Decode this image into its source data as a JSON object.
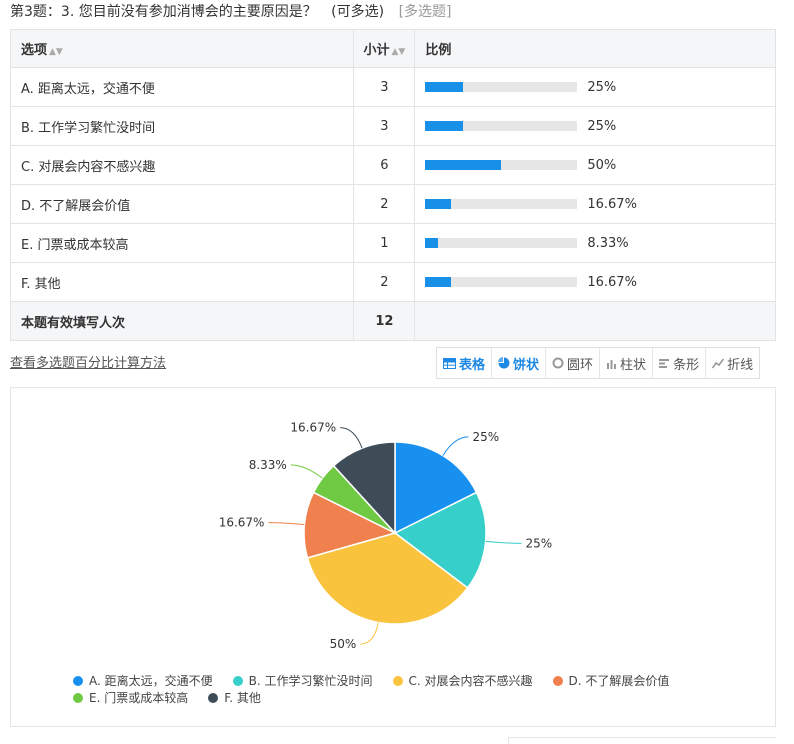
{
  "question": {
    "title": "第3题：3. 您目前没有参加消博会的主要原因是？",
    "note": "(可多选)",
    "type": "[多选题]"
  },
  "table": {
    "headers": {
      "option": "选项",
      "count": "小计",
      "ratio": "比例"
    },
    "rows": [
      {
        "label": "A. 距离太远，交通不便",
        "count": "3",
        "pct": "25%",
        "ratio": 0.25
      },
      {
        "label": "B. 工作学习繁忙没时间",
        "count": "3",
        "pct": "25%",
        "ratio": 0.25
      },
      {
        "label": "C. 对展会内容不感兴趣",
        "count": "6",
        "pct": "50%",
        "ratio": 0.5
      },
      {
        "label": "D. 不了解展会价值",
        "count": "2",
        "pct": "16.67%",
        "ratio": 0.1667
      },
      {
        "label": "E. 门票或成本较高",
        "count": "1",
        "pct": "8.33%",
        "ratio": 0.0833
      },
      {
        "label": "F. 其他",
        "count": "2",
        "pct": "16.67%",
        "ratio": 0.1667
      }
    ],
    "total_label": "本题有效填写人次",
    "total_value": "12"
  },
  "link_text": "查看多选题百分比计算方法",
  "toolbar": {
    "buttons": [
      {
        "label": "表格",
        "icon": "table-icon",
        "active": true
      },
      {
        "label": "饼状",
        "icon": "pie-icon",
        "active": true
      },
      {
        "label": "圆环",
        "icon": "ring-icon",
        "active": false
      },
      {
        "label": "柱状",
        "icon": "column-icon",
        "active": false
      },
      {
        "label": "条形",
        "icon": "bar-icon",
        "active": false
      },
      {
        "label": "折线",
        "icon": "line-icon",
        "active": false
      }
    ]
  },
  "colors": {
    "accent": "#1890e8",
    "series": [
      "#1890f0",
      "#36cfc9",
      "#fac33d",
      "#f0804d",
      "#70c943",
      "#3e4c58"
    ]
  },
  "chart_data": {
    "type": "pie",
    "categories": [
      "A. 距离太远，交通不便",
      "B. 工作学习繁忙没时间",
      "C. 对展会内容不感兴趣",
      "D. 不了解展会价值",
      "E. 门票或成本较高",
      "F. 其他"
    ],
    "values": [
      3,
      3,
      6,
      2,
      1,
      2
    ],
    "labels": [
      "25%",
      "25%",
      "50%",
      "16.67%",
      "8.33%",
      "16.67%"
    ],
    "legend": "bottom"
  }
}
